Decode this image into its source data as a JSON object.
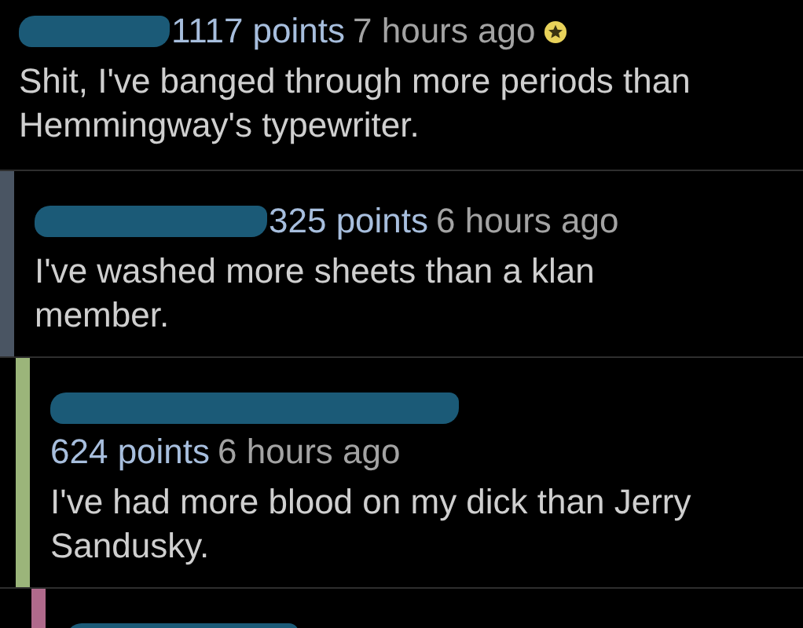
{
  "comments": [
    {
      "points": "1117 points",
      "time": "7 hours ago",
      "gilded": true,
      "body": "Shit, I've banged through more periods than Hemmingway's typewriter.",
      "children": [
        {
          "color": "#4a5563",
          "points": "325 points",
          "time": "6 hours ago",
          "body": "I've washed more sheets than a klan member.",
          "children": [
            {
              "color": "#9bb57a",
              "points": "624 points",
              "time": "6 hours ago",
              "body": "I've had more blood on my dick than Jerry Sandusky.",
              "children": [
                {
                  "color": "#b06a8c"
                }
              ]
            }
          ]
        }
      ]
    }
  ]
}
